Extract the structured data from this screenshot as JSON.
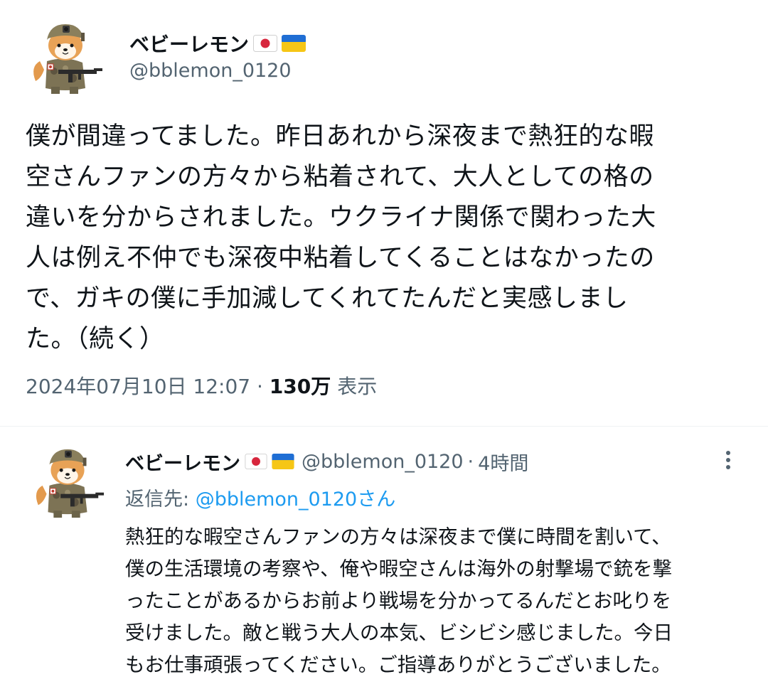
{
  "main_post": {
    "display_name": "ベビーレモン",
    "handle": "@bblemon_0120",
    "flags": [
      "japan-flag",
      "ukraine-flag"
    ],
    "text_lines": [
      "僕が間違ってました。昨日あれから深夜まで熱狂的な暇",
      "空さんファンの方々から粘着されて、大人としての格の",
      "違いを分からされました。ウクライナ関係で関わった大",
      "人は例え不仲でも深夜中粘着してくることはなかったの",
      "で、ガキの僕に手加減してくれてたんだと実感しまし",
      "た。（続く）"
    ],
    "timestamp": "2024年07月10日 12:07",
    "separator": "·",
    "views_count": "130万",
    "views_label": "表示"
  },
  "reply_post": {
    "display_name": "ベビーレモン",
    "handle": "@bblemon_0120",
    "separator": "·",
    "time": "4時間",
    "reply_to_label": "返信先:",
    "reply_to_mention": "@bblemon_0120さん",
    "text_lines": [
      "熱狂的な暇空さんファンの方々は深夜まで僕に時間を割いて、",
      "僕の生活環境の考察や、俺や暇空さんは海外の射撃場で銃を撃",
      "ったことがあるからお前より戦場を分かってるんだとお叱りを",
      "受けました。敵と戦う大人の本気、ビシビシ感じました。今日",
      "もお仕事頑張ってください。ご指導ありがとうございました。"
    ]
  },
  "colors": {
    "text_primary": "#0f1419",
    "text_secondary": "#536471",
    "link": "#1d9bf0",
    "divider": "#eff3f4"
  },
  "icons": [
    "avatar-shiba-soldier",
    "japan-flag",
    "ukraine-flag",
    "more-options-icon"
  ]
}
